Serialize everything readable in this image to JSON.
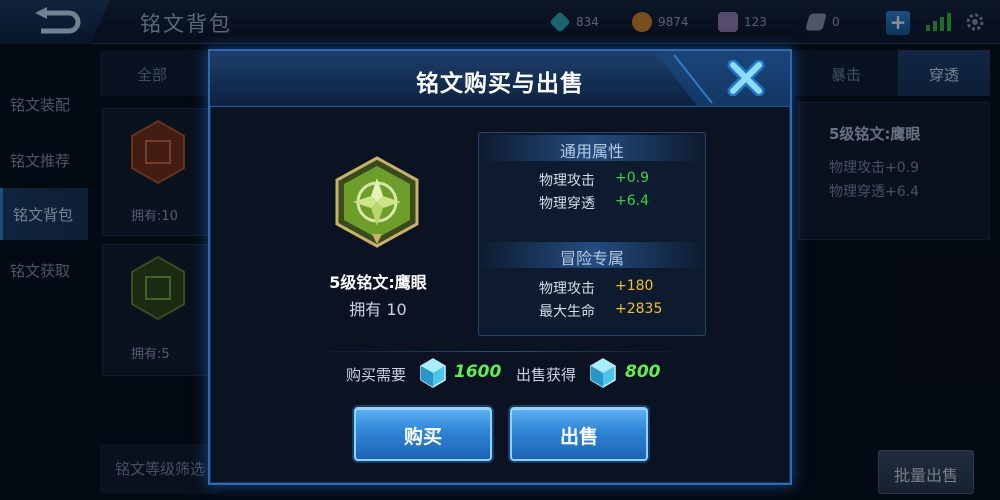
{
  "topbar": {
    "page_title": "铭文背包",
    "resources": [
      {
        "icon": "diamond-icon",
        "value": "834",
        "color": "#2fb3b8"
      },
      {
        "icon": "gold-coin-icon",
        "value": "9874",
        "color": "#d98a2b"
      },
      {
        "icon": "gem-pack-icon",
        "value": "123",
        "color": "#9a86b8"
      },
      {
        "icon": "ticket-icon",
        "value": "0",
        "color": "#8e9aae"
      }
    ]
  },
  "sidebar": {
    "items": [
      {
        "label": "铭文装配"
      },
      {
        "label": "铭文推荐"
      },
      {
        "label": "铭文背包"
      },
      {
        "label": "铭文获取"
      }
    ]
  },
  "tabs": [
    {
      "label": "全部"
    },
    {
      "label": "暴击"
    },
    {
      "label": "穿透"
    }
  ],
  "inventory": [
    {
      "own_label": "拥有:10",
      "color": "#c2552a"
    },
    {
      "own_label": "拥有:5",
      "color": "#5e8a2e"
    }
  ],
  "detail": {
    "title": "5级铭文:鹰眼",
    "lines": [
      "物理攻击+0.9",
      "物理穿透+6.4"
    ]
  },
  "footer": {
    "filter_label": "铭文等级筛选",
    "bulk_sell_label": "批量出售"
  },
  "modal": {
    "title": "铭文购买与出售",
    "rune": {
      "name": "5级铭文:鹰眼",
      "own": "拥有 10"
    },
    "general": {
      "header": "通用属性",
      "rows": [
        {
          "name": "物理攻击",
          "value": "+0.9"
        },
        {
          "name": "物理穿透",
          "value": "+6.4"
        }
      ]
    },
    "adventure": {
      "header": "冒险专属",
      "rows": [
        {
          "name": "物理攻击",
          "value": "+180"
        },
        {
          "name": "最大生命",
          "value": "+2835"
        }
      ]
    },
    "buy_cost_label": "购买需要",
    "buy_cost_value": "1600",
    "sell_gain_label": "出售获得",
    "sell_gain_value": "800",
    "buy_button": "购买",
    "sell_button": "出售"
  }
}
